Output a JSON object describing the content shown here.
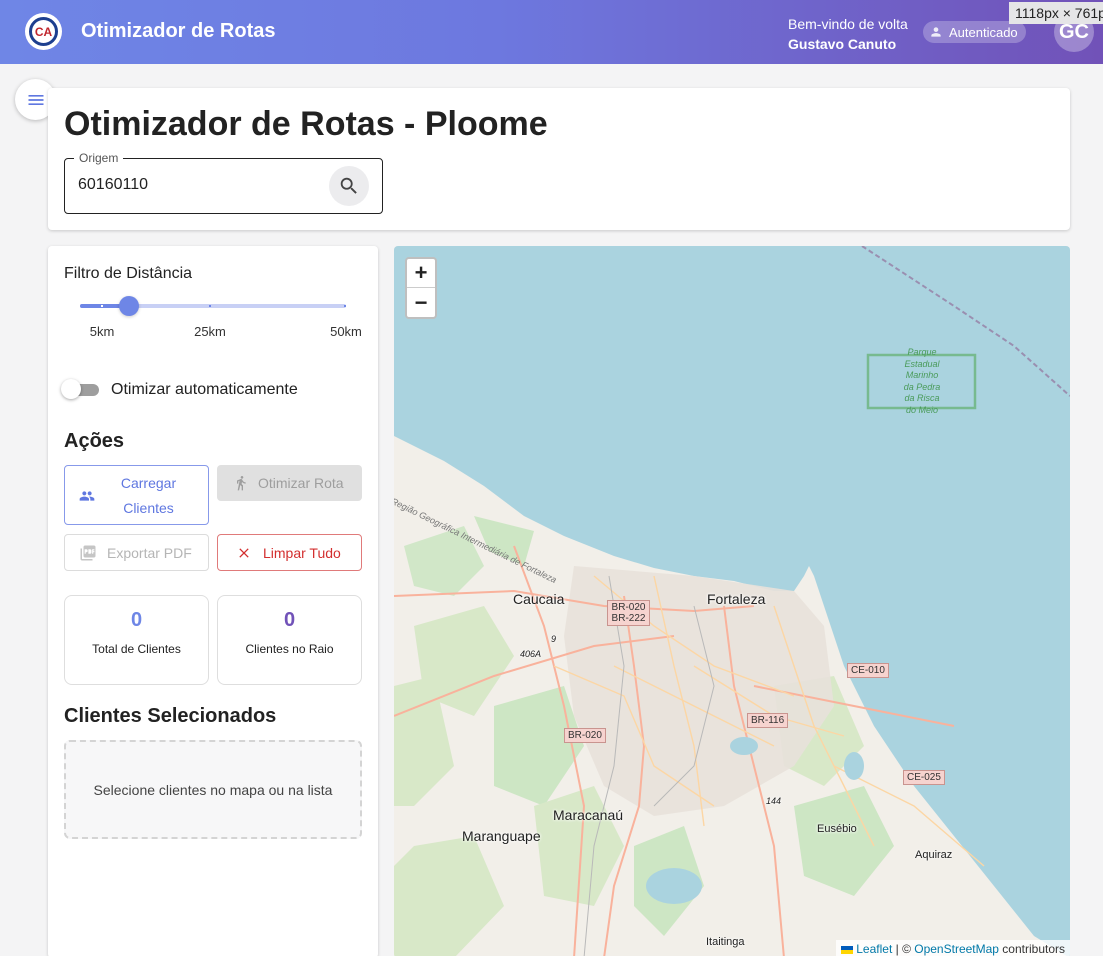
{
  "header": {
    "app_title": "Otimizador de Rotas",
    "logo_text": "CA",
    "welcome": "Bem-vindo de volta",
    "user_name": "Gustavo Canuto",
    "auth_status": "Autenticado",
    "avatar_initials": "GC",
    "dimension_badge": "1118px × 761px"
  },
  "page": {
    "title": "Otimizador de Rotas - Ploome",
    "origin": {
      "label": "Origem",
      "value": "60160110"
    }
  },
  "sidebar": {
    "filter_label": "Filtro de Distância",
    "slider": {
      "value_km": 10,
      "min_km": 5,
      "max_km": 50,
      "marks": [
        "5km",
        "25km",
        "50km"
      ]
    },
    "auto_optimize_label": "Otimizar automaticamente",
    "auto_optimize_on": false,
    "actions_title": "Ações",
    "actions": {
      "load_clients": "Carregar Clientes",
      "optimize_route": "Otimizar Rota",
      "export_pdf": "Exportar PDF",
      "clear_all": "Limpar Tudo"
    },
    "stats": [
      {
        "value": "0",
        "label": "Total de Clientes",
        "color": "#6e86e6"
      },
      {
        "value": "0",
        "label": "Clientes no Raio",
        "color": "#7152b8"
      }
    ],
    "selected_title": "Clientes Selecionados",
    "selected_empty": "Selecione clientes no mapa ou na lista"
  },
  "map": {
    "zoom_in": "+",
    "zoom_out": "−",
    "attribution": {
      "leaflet": "Leaflet",
      "separator": " | © ",
      "osm": "OpenStreetMap",
      "suffix": " contributors"
    },
    "labels": {
      "park": "Parque Estadual Marinho da Pedra da Risca do Meio",
      "region": "Região Geográfica Intermediária de Fortaleza",
      "caucaia": "Caucaia",
      "fortaleza": "Fortaleza",
      "maracanau": "Maracanaú",
      "maranguape": "Maranguape",
      "eusebio": "Eusébio",
      "aquiraz": "Aquiraz",
      "itaitinga": "Itaitinga",
      "r406a": "406A",
      "r9": "9",
      "r144": "144"
    },
    "shields": {
      "br020_222": "BR-020 BR-222",
      "br020_a": "BR-020",
      "br020_b": "BR-020",
      "br116": "BR-116",
      "ce010": "CE-010",
      "ce025": "CE-025"
    }
  }
}
